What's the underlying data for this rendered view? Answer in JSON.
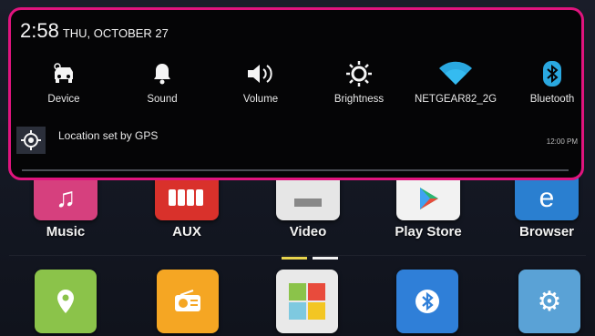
{
  "status": {
    "time": "2:58",
    "date": "THU, OCTOBER 27"
  },
  "quick_settings": [
    {
      "label": "Device",
      "icon": "car-icon"
    },
    {
      "label": "Sound",
      "icon": "bell-icon"
    },
    {
      "label": "Volume",
      "icon": "speaker-icon"
    },
    {
      "label": "Brightness",
      "icon": "sun-icon"
    },
    {
      "label": "NETGEAR82_2G",
      "icon": "wifi-icon"
    },
    {
      "label": "Bluetooth",
      "icon": "bluetooth-icon"
    }
  ],
  "notification": {
    "text": "Location set by GPS",
    "time": "12:00 PM",
    "icon": "gps-icon"
  },
  "home": {
    "row1": [
      {
        "label": "Music",
        "icon": "music-icon",
        "color": "#d6407e"
      },
      {
        "label": "AUX",
        "icon": "aux-icon",
        "color": "#d9312b"
      },
      {
        "label": "Video",
        "icon": "video-icon",
        "color": "#e6e6e6"
      },
      {
        "label": "Play Store",
        "icon": "play-store-icon",
        "color": "#f2f2f2"
      },
      {
        "label": "Browser",
        "icon": "browser-icon",
        "color": "#2a7fd0"
      }
    ],
    "row2": [
      {
        "icon": "maps-icon",
        "color": "#8bc34a"
      },
      {
        "icon": "radio-icon",
        "color": "#f5a623"
      },
      {
        "icon": "gallery-icon",
        "color": "#e9e9e9"
      },
      {
        "icon": "bluetooth-icon",
        "color": "#2f7fd8"
      },
      {
        "icon": "settings-icon",
        "color": "#5aa2d6"
      }
    ]
  },
  "colors": {
    "shade_border": "#e0147e",
    "dot_active": "#e8d44d",
    "dot_inactive": "#f2f2f2"
  }
}
